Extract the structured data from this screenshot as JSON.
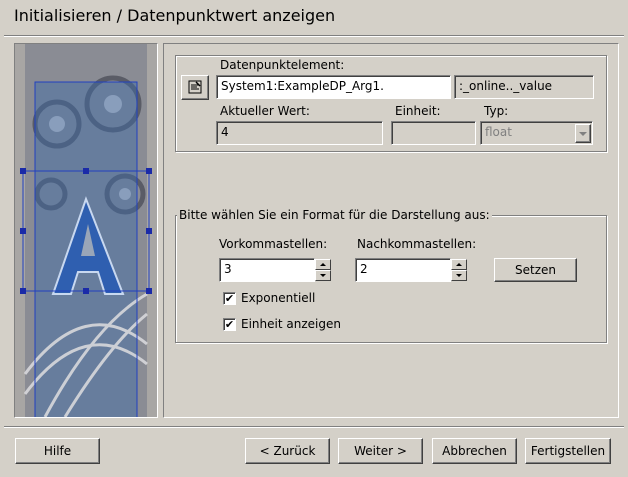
{
  "window": {
    "title": "Initialisieren / Datenpunktwert anzeigen"
  },
  "dp": {
    "label": "Datenpunktelement:",
    "value": "System1:ExampleDP_Arg1.",
    "config": ":_online.._value",
    "current_label": "Aktueller Wert:",
    "current_value": "4",
    "unit_label": "Einheit:",
    "unit_value": "",
    "type_label": "Typ:",
    "type_value": "float"
  },
  "format": {
    "legend": "Bitte wählen Sie ein Format für die Darstellung aus:",
    "pre_label": "Vorkommastellen:",
    "pre_value": "3",
    "post_label": "Nachkommastellen:",
    "post_value": "2",
    "set_label": "Setzen",
    "exp_label": "Exponentiell",
    "exp_checked": "✔",
    "unit_show_label": "Einheit anzeigen",
    "unit_show_checked": "✔"
  },
  "footer": {
    "help": "Hilfe",
    "back": "< Zurück",
    "next": "Weiter >",
    "cancel": "Abbrechen",
    "finish": "Fertigstellen"
  },
  "icons": {
    "dp_selector": "dp-selector-icon",
    "dropdown": "chevron-down-icon",
    "spin_up": "spin-up-icon",
    "spin_down": "spin-down-icon"
  }
}
